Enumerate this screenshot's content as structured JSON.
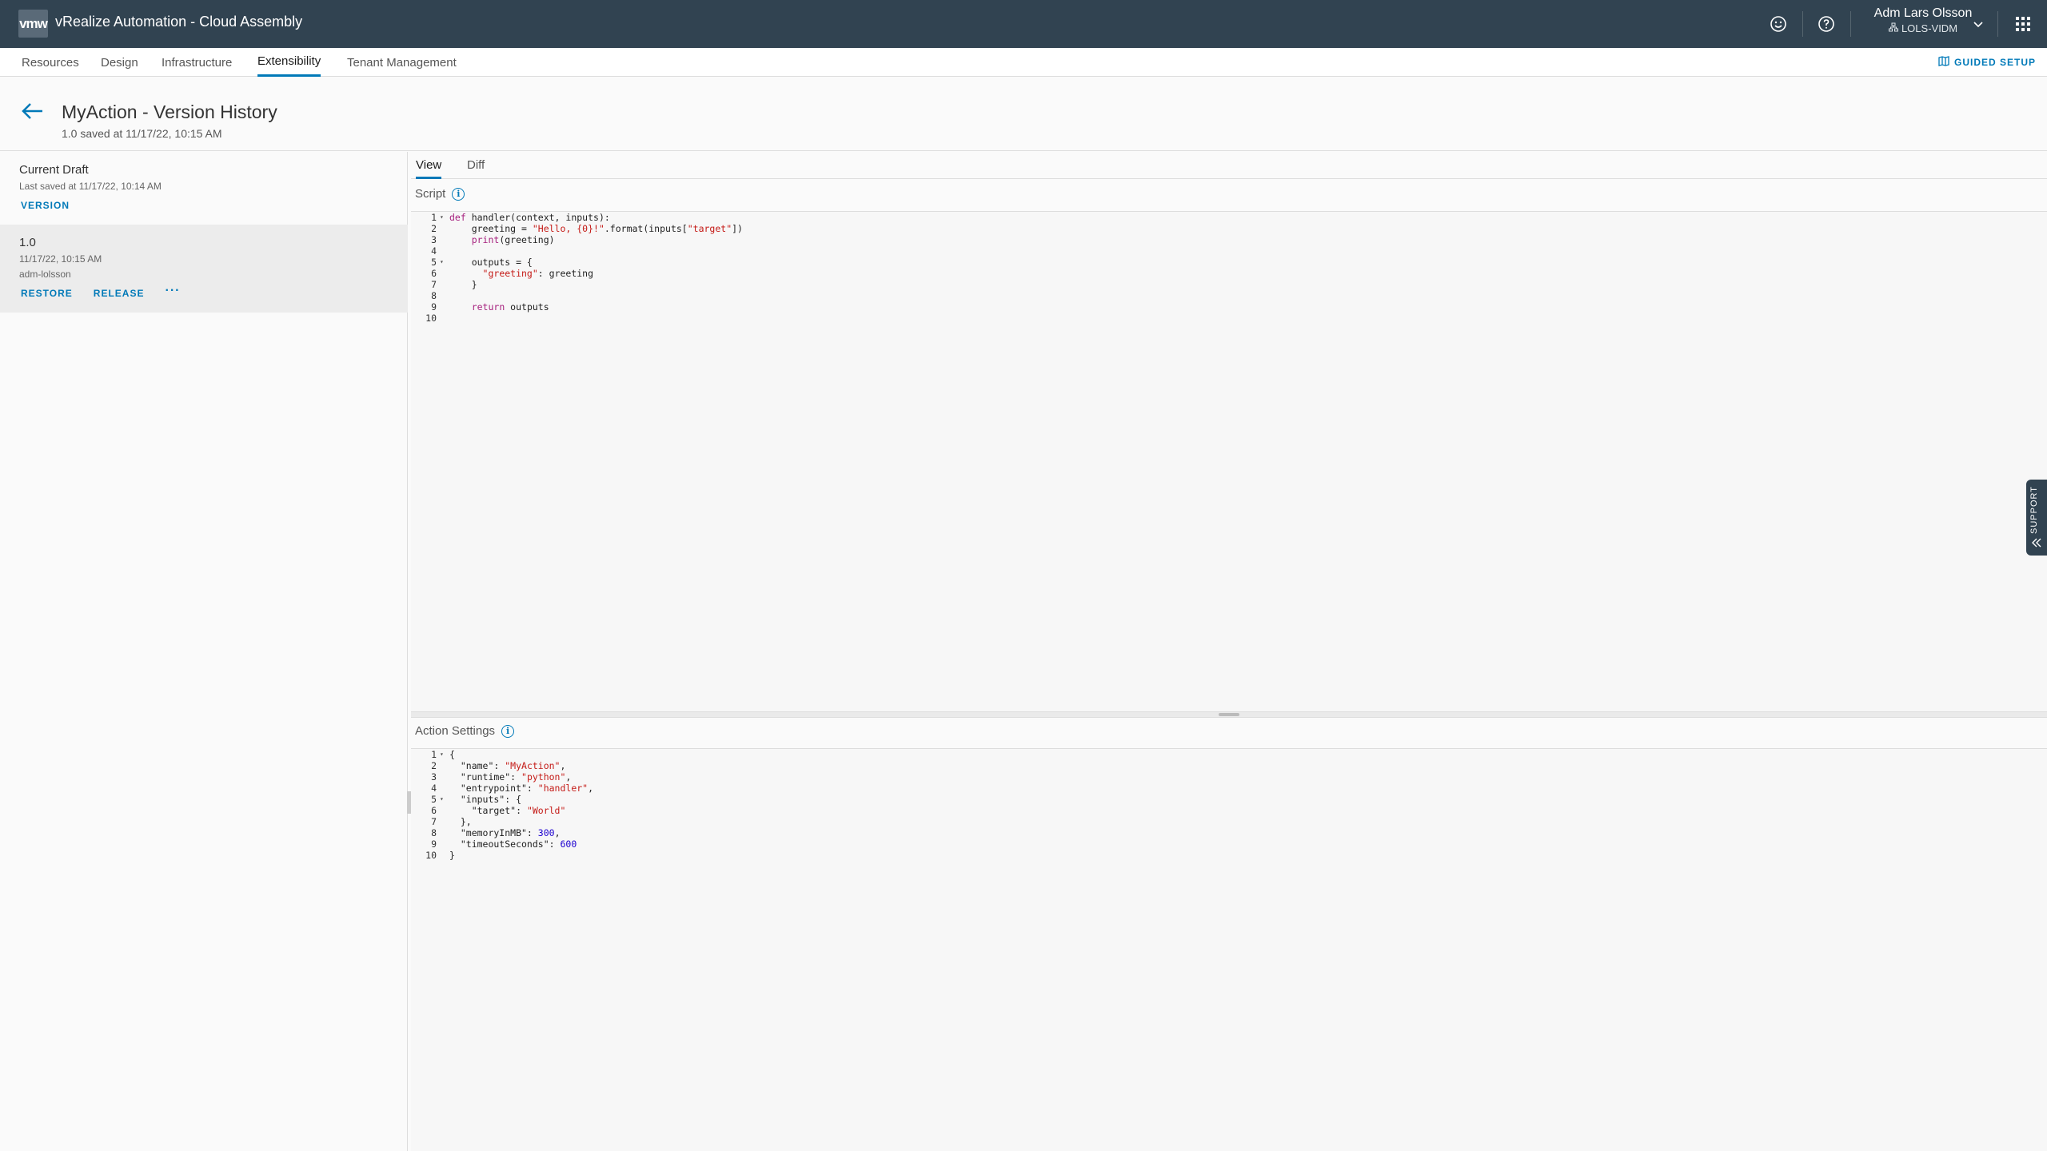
{
  "header": {
    "logo_text": "vmw",
    "app_title": "vRealize Automation - Cloud Assembly",
    "user_name": "Adm Lars Olsson",
    "user_tenant": "LOLS-VIDM"
  },
  "nav": {
    "tabs": [
      "Resources",
      "Design",
      "Infrastructure",
      "Extensibility",
      "Tenant Management"
    ],
    "active": "Extensibility",
    "guided_setup": "GUIDED SETUP"
  },
  "page": {
    "title": "MyAction - Version History",
    "subtitle": "1.0 saved at 11/17/22, 10:15 AM"
  },
  "versions": {
    "draft": {
      "title": "Current Draft",
      "meta": "Last saved at 11/17/22, 10:14 AM",
      "action": "VERSION"
    },
    "v1": {
      "title": "1.0",
      "date": "11/17/22, 10:15 AM",
      "user": "adm-lolsson",
      "restore": "RESTORE",
      "release": "RELEASE",
      "more": "···"
    }
  },
  "editor": {
    "tabs": [
      "View",
      "Diff"
    ],
    "script_label": "Script",
    "settings_label": "Action Settings",
    "script_lines": [
      "def handler(context, inputs):",
      "    greeting = \"Hello, {0}!\".format(inputs[\"target\"])",
      "    print(greeting)",
      "",
      "    outputs = {",
      "      \"greeting\": greeting",
      "    }",
      "",
      "    return outputs",
      ""
    ],
    "settings_lines": [
      "{",
      "  \"name\": \"MyAction\",",
      "  \"runtime\": \"python\",",
      "  \"entrypoint\": \"handler\",",
      "  \"inputs\": {",
      "    \"target\": \"World\"",
      "  },",
      "  \"memoryInMB\": 300,",
      "  \"timeoutSeconds\": 600",
      "}"
    ]
  },
  "support": {
    "label": "SUPPORT"
  },
  "colors": {
    "header_bg": "#314351",
    "accent": "#0079b8"
  }
}
